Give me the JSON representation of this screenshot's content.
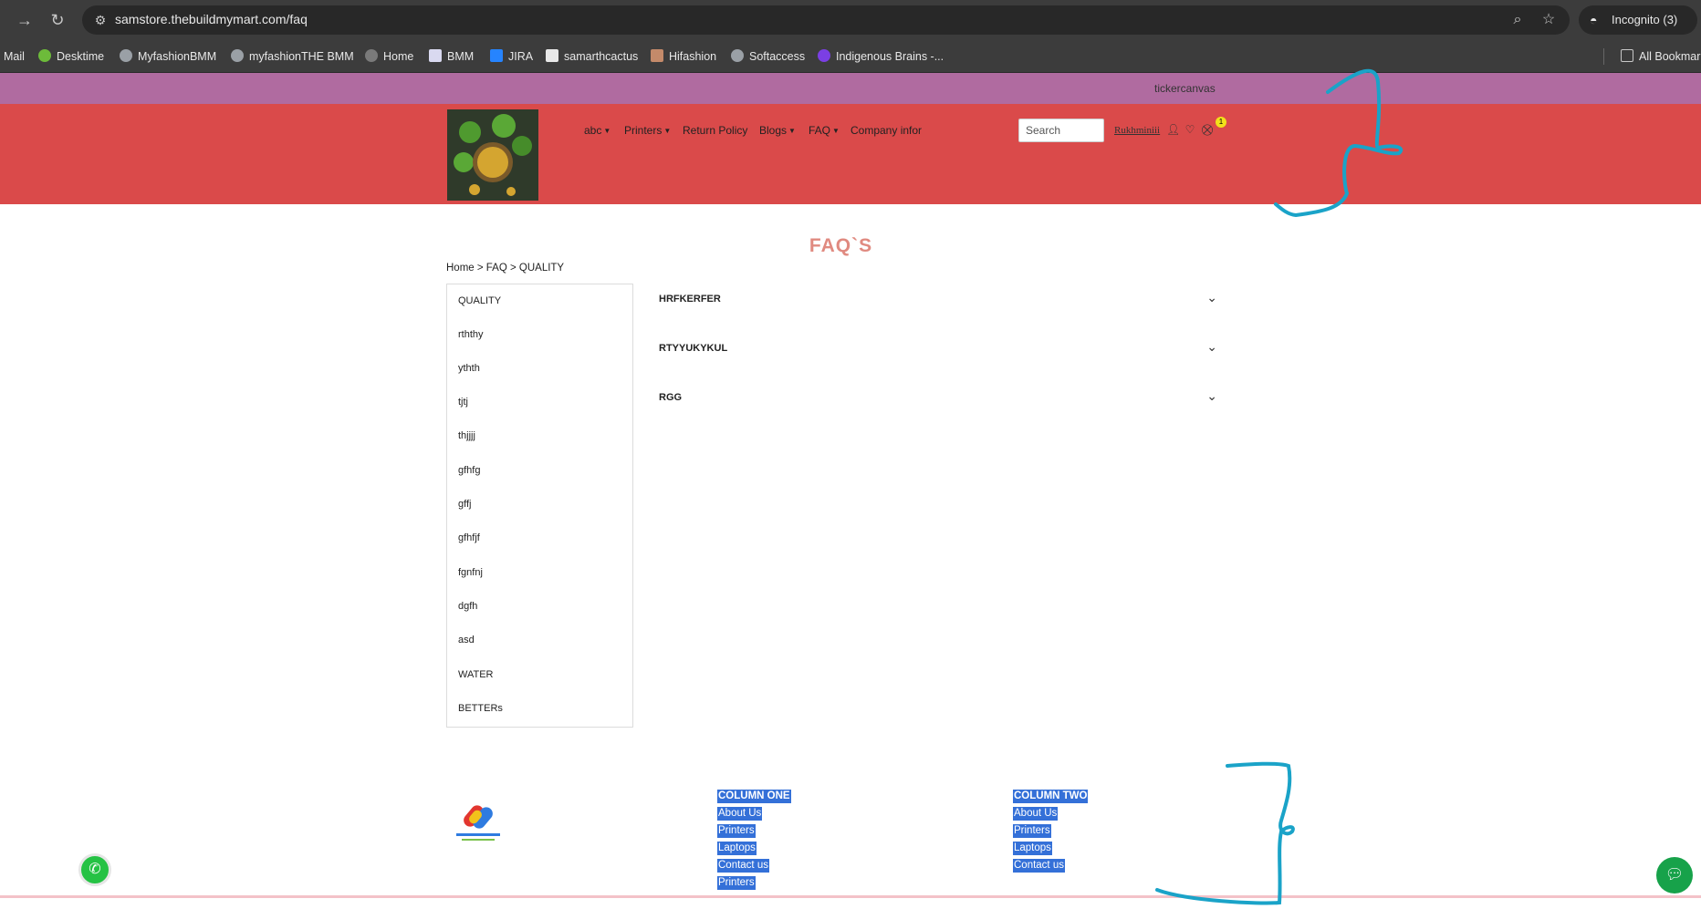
{
  "browser": {
    "url": "samstore.thebuildmymart.com/faq",
    "incognito_label": "Incognito (3)",
    "bookmarks": [
      "Mail",
      "Desktime",
      "MyfashionBMM",
      "myfashionTHE BMM",
      "Home",
      "BMM",
      "JIRA",
      "samarthcactus",
      "Hifashion",
      "Softaccess",
      "Indigenous Brains -..."
    ],
    "all_bookmarks": "All Bookmar"
  },
  "ticker": {
    "text": "tickercanvas"
  },
  "header": {
    "nav": [
      "abc",
      "Printers",
      "Return Policy",
      "Blogs",
      "FAQ",
      "Company infor"
    ],
    "search_placeholder": "Search",
    "user": "Rukhminiii",
    "cart_count": "1"
  },
  "page": {
    "title": "FAQ`S",
    "breadcrumb": "Home > FAQ > QUALITY"
  },
  "sidebar": {
    "items": [
      "QUALITY",
      "rththy",
      "ythth",
      "tjtj",
      "thjjjj",
      "gfhfg",
      "gffj",
      "gfhfjf",
      "fgnfnj",
      "dgfh",
      "asd",
      "WATER",
      "BETTERs"
    ]
  },
  "faqs": [
    {
      "question": "HRFKERFER"
    },
    {
      "question": "RTYYUKYKUL"
    },
    {
      "question": "RGG"
    }
  ],
  "footer": {
    "column_one": {
      "title": "COLUMN ONE",
      "links": [
        "About Us",
        "Printers",
        "Laptops",
        "Contact us",
        "Printers"
      ]
    },
    "column_two": {
      "title": "COLUMN TWO",
      "links": [
        "About Us",
        "Printers",
        "Laptops",
        "Contact us"
      ]
    }
  },
  "colors": {
    "header": "#da4a4a",
    "ticker": "#b06ba0",
    "title": "#e08a80",
    "footer_highlight": "#3470d8",
    "scribble": "#1aa3c8"
  }
}
